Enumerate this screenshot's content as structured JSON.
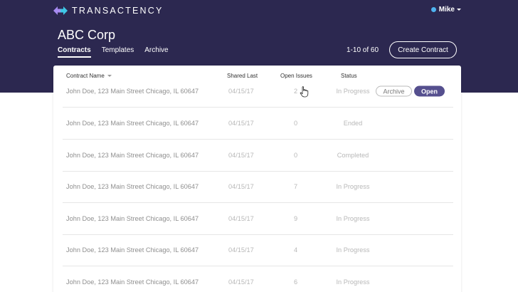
{
  "brand": {
    "name": "TRANSACTENCY",
    "icon": "double-arrow-logo-icon",
    "colors": {
      "left": "#a78bf2",
      "right": "#3fc7e6"
    }
  },
  "user": {
    "name": "Mike",
    "status_color": "#4fb3f0"
  },
  "company": "ABC Corp",
  "tabs": [
    {
      "label": "Contracts",
      "active": true
    },
    {
      "label": "Templates",
      "active": false
    },
    {
      "label": "Archive",
      "active": false
    }
  ],
  "pagination": "1-10 of 60",
  "create_button": "Create Contract",
  "table": {
    "headers": {
      "name": "Contract Name",
      "shared": "Shared Last",
      "issues": "Open Issues",
      "status": "Status"
    },
    "rows": [
      {
        "name": "John Doe, 123 Main Street Chicago, IL 60647",
        "shared": "04/15/17",
        "issues": "2",
        "status": "In Progress"
      },
      {
        "name": "John Doe, 123 Main Street Chicago, IL 60647",
        "shared": "04/15/17",
        "issues": "0",
        "status": "Ended"
      },
      {
        "name": "John Doe, 123 Main Street Chicago, IL 60647",
        "shared": "04/15/17",
        "issues": "0",
        "status": "Completed"
      },
      {
        "name": "John Doe, 123 Main Street Chicago, IL 60647",
        "shared": "04/15/17",
        "issues": "7",
        "status": "In Progress"
      },
      {
        "name": "John Doe, 123 Main Street Chicago, IL 60647",
        "shared": "04/15/17",
        "issues": "9",
        "status": "In Progress"
      },
      {
        "name": "John Doe, 123 Main Street Chicago, IL 60647",
        "shared": "04/15/17",
        "issues": "4",
        "status": "In Progress"
      },
      {
        "name": "John Doe, 123 Main Street Chicago, IL 60647",
        "shared": "04/15/17",
        "issues": "6",
        "status": "In Progress"
      }
    ],
    "row_actions": {
      "archive": "Archive",
      "open": "Open"
    }
  },
  "theme": {
    "header_bg": "#2c2850",
    "accent": "#554f8e"
  }
}
